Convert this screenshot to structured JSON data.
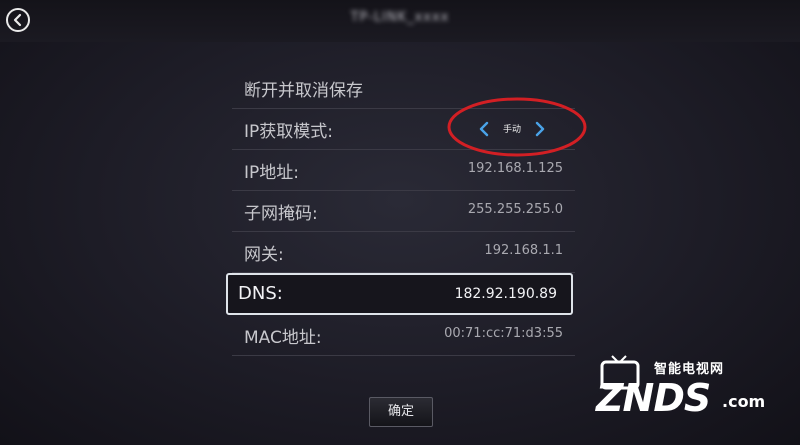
{
  "header": {
    "title": "TP-LINK_xxxx",
    "back_icon": "chevron-left-icon"
  },
  "settings": {
    "header_text": "断开并取消保存",
    "rows": [
      {
        "label": "IP获取模式:",
        "value": "手动"
      },
      {
        "label": "IP地址:",
        "value": "192.168.1.125"
      },
      {
        "label": "子网掩码:",
        "value": "255.255.255.0"
      },
      {
        "label": "网关:",
        "value": "192.168.1.1"
      },
      {
        "label": "DNS:",
        "value": "182.92.190.89"
      },
      {
        "label": "MAC地址:",
        "value": "00:71:cc:71:d3:55"
      }
    ],
    "focused_row": "DNS:"
  },
  "footer": {
    "confirm_label": "确定"
  },
  "watermark": {
    "top_text": "智能电视网",
    "logo_text": "ZNDS",
    "domain_text": ".com"
  },
  "colors": {
    "accent_arrow": "#4aa3e8",
    "highlight_ellipse": "#d21f24",
    "focus_border": "#dfe4ea"
  }
}
